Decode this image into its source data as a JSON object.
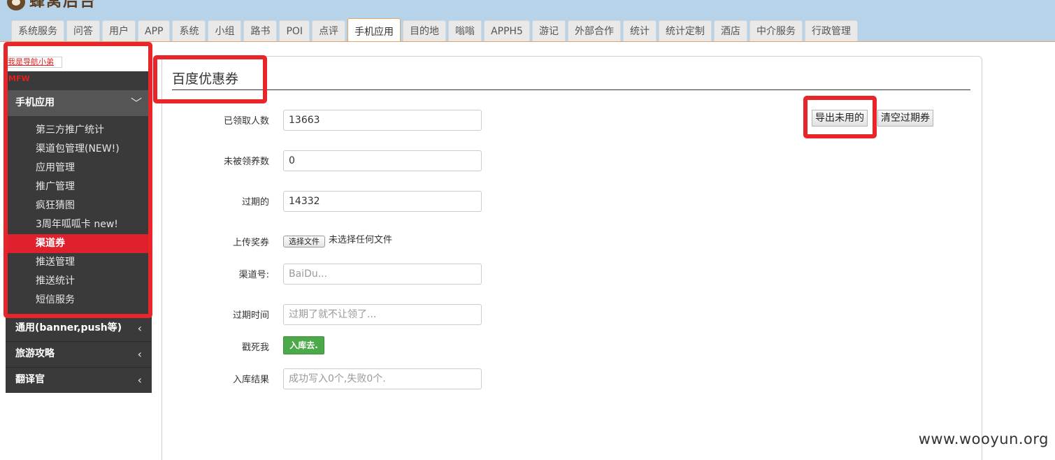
{
  "header": {
    "logo_text": "蜂窝后台",
    "tabs": [
      "系统服务",
      "问答",
      "用户",
      "APP",
      "系统",
      "小组",
      "路书",
      "POI",
      "点评",
      "手机应用",
      "目的地",
      "嗡嗡",
      "APPH5",
      "游记",
      "外部合作",
      "统计",
      "统计定制",
      "酒店",
      "中介服务",
      "行政管理"
    ],
    "active_tab": "手机应用"
  },
  "sidebar": {
    "nav_link": "我是导航小弟",
    "code": "MFW",
    "sections": [
      {
        "label": "手机应用",
        "expanded": true
      },
      {
        "label": "通用(banner,push等)",
        "expanded": false
      },
      {
        "label": "旅游攻略",
        "expanded": false
      },
      {
        "label": "翻译官",
        "expanded": false
      }
    ],
    "items": [
      "第三方推广统计",
      "渠道包管理(NEW!)",
      "应用管理",
      "推广管理",
      "疯狂猜图",
      "3周年呱呱卡 new!",
      "渠道券",
      "推送管理",
      "推送统计",
      "短信服务"
    ],
    "active_item": "渠道券"
  },
  "main": {
    "title": "百度优惠券",
    "fields": {
      "received_label": "已领取人数",
      "received_value": "13663",
      "unclaimed_label": "未被领养数",
      "unclaimed_value": "0",
      "expired_label": "过期的",
      "expired_value": "14332",
      "upload_label": "上传奖券",
      "upload_button": "选择文件",
      "upload_status": "未选择任何文件",
      "channel_label": "渠道号:",
      "channel_placeholder": "BaiDu...",
      "expire_time_label": "过期时间",
      "expire_time_placeholder": "过期了就不让领了...",
      "submit_label": "戳死我",
      "submit_button": "入库去.",
      "result_label": "入库结果",
      "result_placeholder": "成功写入0个,失败0个."
    },
    "export_unused_button": "导出未用的",
    "clear_expired_button": "清空过期券"
  },
  "watermark": "www.wooyun.org",
  "colors": {
    "header_bg": "#b7d3ea",
    "sidebar_bg": "#3a3a3a",
    "sidebar_active": "#e0202c",
    "highlight": "#e8262a",
    "success_button": "#4ca94a"
  }
}
